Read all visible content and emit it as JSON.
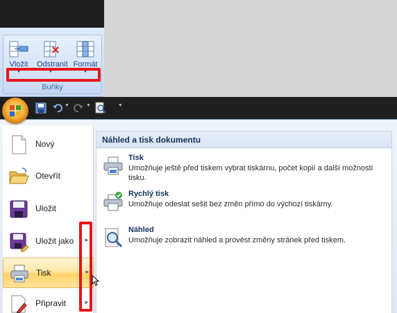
{
  "ribbon": {
    "group_label": "Buňky",
    "buttons": [
      {
        "label": "Vložit",
        "icon": "insert-cells-icon"
      },
      {
        "label": "Odstranit",
        "icon": "delete-cells-icon"
      },
      {
        "label": "Formát",
        "icon": "format-cells-icon"
      }
    ]
  },
  "menu": {
    "items": [
      {
        "label": "Nový",
        "icon": "new-document-icon",
        "has_submenu": false
      },
      {
        "label": "Otevřít",
        "icon": "open-folder-icon",
        "has_submenu": false
      },
      {
        "label": "Uložit",
        "icon": "save-disk-icon",
        "has_submenu": false
      },
      {
        "label": "Uložit jako",
        "icon": "save-as-icon",
        "has_submenu": true
      },
      {
        "label": "Tisk",
        "icon": "printer-icon",
        "has_submenu": true,
        "active": true
      },
      {
        "label": "Připravit",
        "icon": "prepare-icon",
        "has_submenu": true
      }
    ],
    "panel": {
      "header": "Náhled a tisk dokumentu",
      "commands": [
        {
          "title": "Tisk",
          "description": "Umožňuje ještě před tiskem vybrat tiskárnu, počet kopií a další možnosti tisku.",
          "icon": "printer-icon"
        },
        {
          "title": "Rychlý tisk",
          "description": "Umožňuje odeslat sešit bez změn přímo do výchozí tiskárny.",
          "icon": "quick-print-icon"
        },
        {
          "title": "Náhled",
          "description": "Umožňuje zobrazit náhled a provést změny stránek před tiskem.",
          "icon": "print-preview-icon"
        }
      ]
    }
  },
  "colors": {
    "highlight": "#e8141a",
    "active_item": "#ffd36a",
    "ribbon_text": "#15428b"
  }
}
